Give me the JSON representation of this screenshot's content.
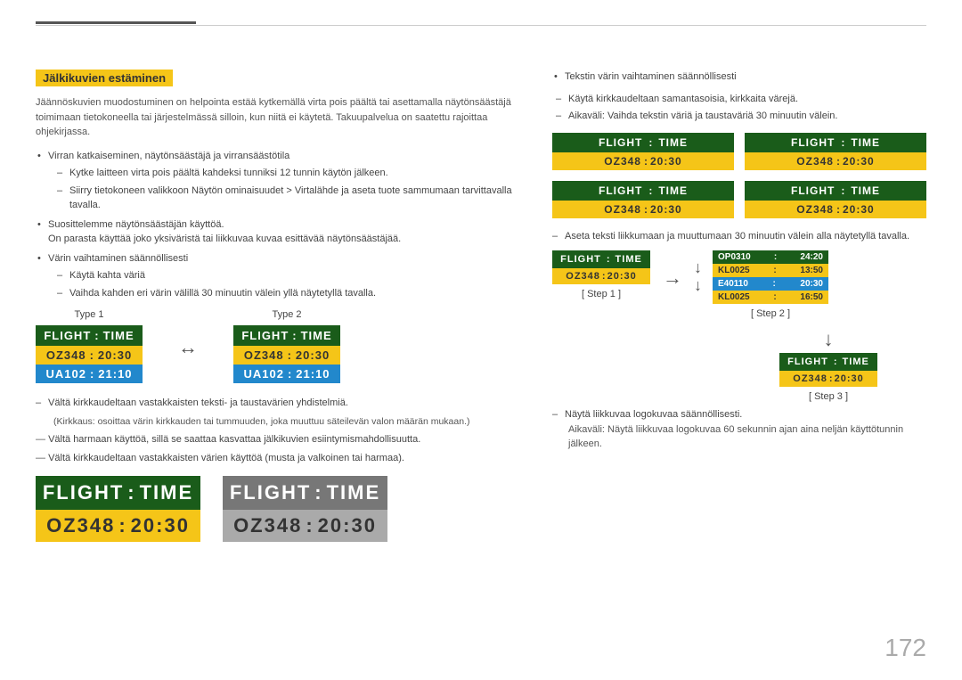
{
  "page": {
    "number": "172",
    "top_rule_accent_color": "#555",
    "top_rule_color": "#ccc"
  },
  "section": {
    "heading": "Jälkikuvien estäminen",
    "intro": "Jäännöskuvien muodostuminen on helpointa estää kytkemällä virta pois päältä tai asettamalla näytönsäästäjä toimimaan tietokoneella tai järjestelmässä silloin, kun niitä ei käytetä. Takuupalvelua on saatettu rajoittaa ohjekirjassa."
  },
  "bullet1": {
    "text": "Virran katkaiseminen, näytönsäästäjä ja virransäästötila"
  },
  "sub1": [
    "Kytke laitteen virta pois päältä kahdeksi tunniksi 12 tunnin käytön jälkeen.",
    "Siirry tietokoneen valikkoon Näytön ominaisuudet > Virtalähde ja aseta tuote sammumaan tarvittavalla tavalla."
  ],
  "bullet2": {
    "text": "Suosittelemme näytönsäästäjän käyttöä.",
    "sub": "On parasta käyttää joko yksiväristä tai liikkuvaa kuvaa esittävää näytönsäästäjää."
  },
  "bullet3": {
    "text": "Värin vaihtaminen säännöllisesti"
  },
  "sub3": [
    "Käytä kahta väriä",
    "Vaihda kahden eri värin välillä 30 minuutin välein yllä näytetyllä tavalla."
  ],
  "type1_label": "Type 1",
  "type2_label": "Type 2",
  "flight_widget": {
    "flight": "FLIGHT",
    "colon": ":",
    "time": "TIME",
    "oz348": "OZ348",
    "colon2": ":",
    "time2": "20:30",
    "ua102": "UA102",
    "colon3": ":",
    "time3": "21:10"
  },
  "warnings": [
    "Vältä kirkkaudeltaan vastakkaisten teksti- ja taustavärien yhdistelmiä.",
    "(Kirkkaus: osoittaa värin kirkkauden tai tummuuden, joka muuttuu säteilevän valon määrän mukaan.)",
    "Vältä harmaan käyttöä, sillä se saattaa kasvattaa jälkikuvien esiintymismahdollisuutta.",
    "Vältä kirkkaudeltaan vastakkaisten värien käyttöä (musta ja valkoinen tai harmaa)."
  ],
  "bottom_widget1": {
    "header_bg": "#1a5c1a",
    "row_bg": "#f5c518",
    "flight": "FLIGHT",
    "colon": ":",
    "time": "TIME",
    "oz348": "OZ348",
    "c2": ":",
    "t2": "20:30"
  },
  "bottom_widget2": {
    "header_bg": "#777",
    "row_bg": "#aaa",
    "flight": "FLIGHT",
    "colon": ":",
    "time": "TIME",
    "oz348": "OZ348",
    "c2": ":",
    "t2": "20:30"
  },
  "right": {
    "bullet1": "Tekstin värin vaihtaminen säännöllisesti",
    "sub1a": "Käytä kirkkaudeltaan samantasoisia, kirkkaita värejä.",
    "sub1b": "Aikaväli: Vaihda tekstin väriä ja taustaväriä 30 minuutin välein.",
    "step_dash": "Aseta teksti liikkumaan ja muuttumaan 30 minuutin välein alla näytetyllä tavalla.",
    "step1_label": "[ Step 1 ]",
    "step2_label": "[ Step 2 ]",
    "step3_label": "[ Step 3 ]",
    "scroll_lines": [
      {
        "code": "OP0310",
        "colon": ":",
        "time": "24:20",
        "bg": "#1a5c1a",
        "color": "#fff"
      },
      {
        "code": "KL0025",
        "colon": ":",
        "time": "13:50",
        "bg": "#f5c518",
        "color": "#333"
      },
      {
        "code": "E40110",
        "colon": ":",
        "time": "20:30",
        "bg": "#2288cc",
        "color": "#fff"
      },
      {
        "code": "KL0025",
        "colon": ":",
        "time": "16:50",
        "bg": "#f5c518",
        "color": "#333"
      }
    ],
    "bottom_dash": "Näytä liikkuvaa logokuvaa säännöllisesti.",
    "bottom_sub": "Aikaväli: Näytä liikkuvaa logokuvaa 60 sekunnin ajan aina neljän käyttötunnin jälkeen."
  },
  "colors": {
    "green_dark": "#1a5c1a",
    "yellow": "#f5c518",
    "blue": "#2288cc",
    "gray_dark": "#555",
    "gray_mid": "#888",
    "gray_light": "#aaa"
  }
}
